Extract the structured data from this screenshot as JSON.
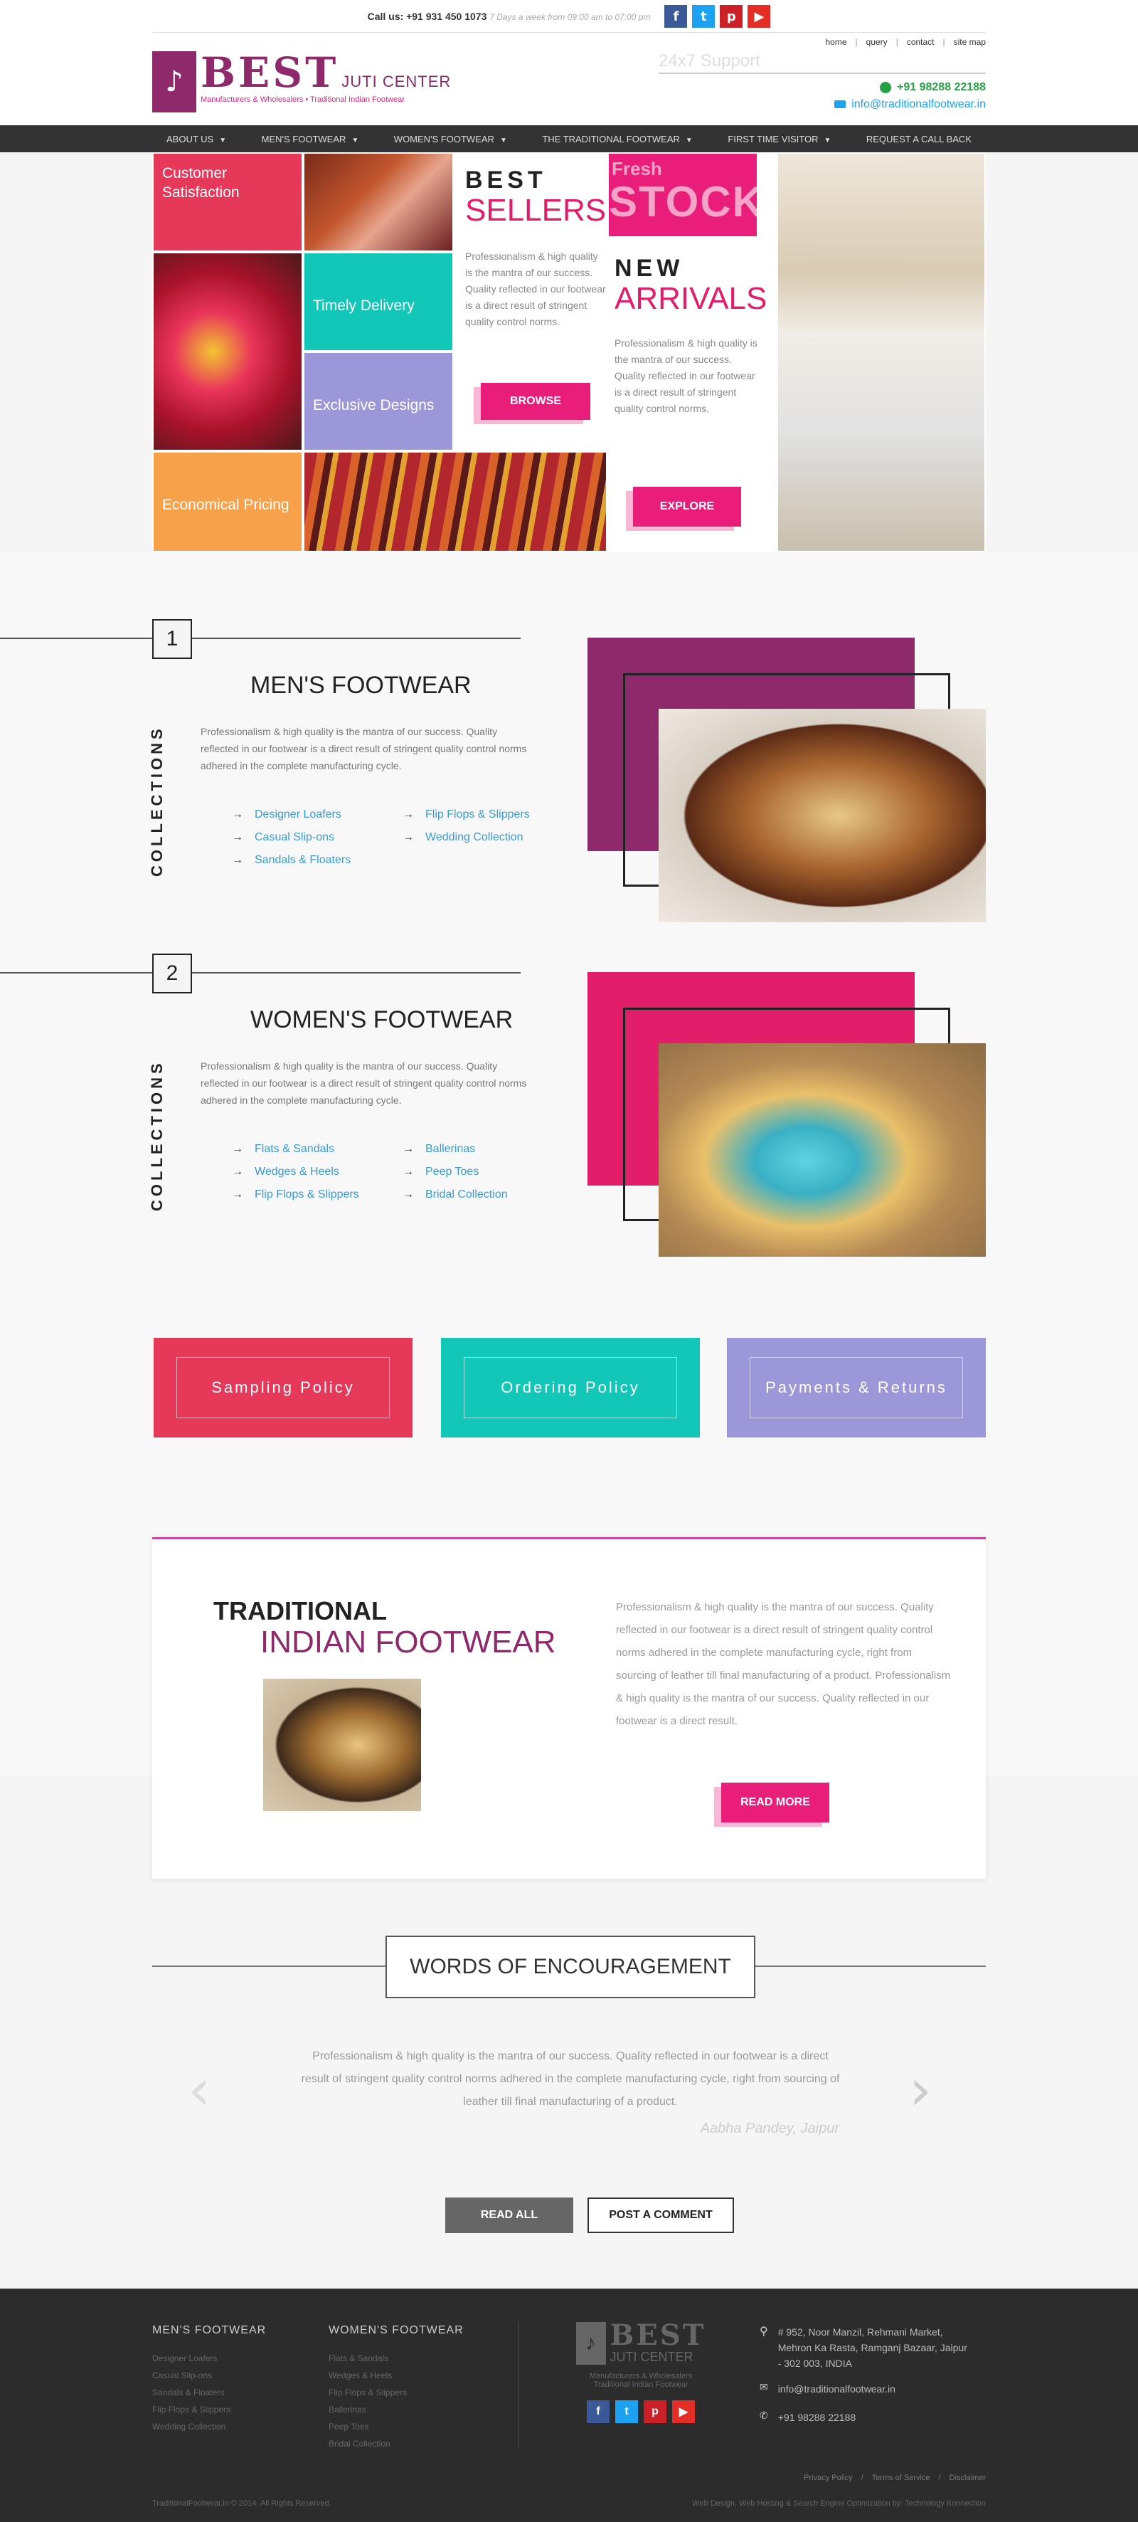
{
  "topbar": {
    "call_label": "Call us:",
    "phone": "+91 931 450 1073",
    "hours": "7 Days a week from 09:00 am to 07:00 pm"
  },
  "toplinks": [
    "home",
    "query",
    "contact",
    "site map"
  ],
  "logo": {
    "best": "BEST",
    "juti": "JUTI CENTER",
    "tagline": "Manufacturers & Wholesalers • Traditional Indian Footwear"
  },
  "support": {
    "title": "24x7 Support",
    "phone": "+91 98288 22188",
    "email": "info@traditionalfootwear.in"
  },
  "nav": [
    {
      "label": "ABOUT US",
      "caret": "▼"
    },
    {
      "label": "MEN'S FOOTWEAR",
      "caret": "▼"
    },
    {
      "label": "WOMEN'S FOOTWEAR",
      "caret": "▼"
    },
    {
      "label": "THE TRADITIONAL FOOTWEAR",
      "caret": "▼"
    },
    {
      "label": "FIRST TIME VISITOR",
      "caret": "▼"
    },
    {
      "label": "REQUEST A CALL BACK",
      "caret": ""
    }
  ],
  "hero": {
    "tiles": [
      "Customer Satisfaction",
      "Timely Delivery",
      "Exclusive Designs",
      "Economical Pricing"
    ],
    "best": "BEST",
    "sellers": "SELLERS",
    "best_text": "Professionalism & high quality is the mantra of our success. Quality reflected in our footwear is a direct result of stringent quality control norms.",
    "browse": "BROWSE",
    "fresh": "Fresh",
    "stock": "STOCK",
    "new": "NEW",
    "arrivals": "ARRIVALS",
    "new_text": "Professionalism & high quality is the mantra of our success. Quality reflected in our footwear is a direct result of stringent quality control norms.",
    "explore": "EXPLORE"
  },
  "collections": [
    {
      "num": "1",
      "vertical": "COLLECTIONS",
      "title": "MEN'S FOOTWEAR",
      "text": "Professionalism & high quality is the mantra of our success. Quality reflected in our footwear is a direct result of stringent quality control norms adhered in the complete manufacturing cycle.",
      "links": [
        "Designer Loafers",
        "Flip Flops & Slippers",
        "Casual Slip-ons",
        "Wedding Collection",
        "Sandals & Floaters"
      ],
      "accent": "#8e2a6b"
    },
    {
      "num": "2",
      "vertical": "COLLECTIONS",
      "title": "WOMEN'S FOOTWEAR",
      "text": "Professionalism & high quality is the mantra of our success. Quality reflected in our footwear is a direct result of stringent quality control norms adhered in the complete manufacturing cycle.",
      "links": [
        "Flats & Sandals",
        "Ballerinas",
        "Wedges & Heels",
        "Peep Toes",
        "Flip Flops & Slippers",
        "Bridal Collection"
      ],
      "accent": "#e21e6b"
    }
  ],
  "policies": [
    {
      "label": "Sampling Policy",
      "color": "#e6395a"
    },
    {
      "label": "Ordering Policy",
      "color": "#12c7b8"
    },
    {
      "label": "Payments & Returns",
      "color": "#9b97d8"
    }
  ],
  "traditional": {
    "line1": "TRADITIONAL",
    "line2": "INDIAN FOOTWEAR",
    "text": "Professionalism & high quality is the mantra of our success. Quality reflected in our footwear is a direct result of stringent quality control norms adhered in the complete manufacturing cycle, right from sourcing of leather till final manufacturing of a product. Professionalism & high quality is the mantra of our success. Quality reflected in our footwear is a direct result.",
    "button": "READ MORE"
  },
  "words": {
    "title": "WORDS OF ENCOURAGEMENT",
    "quote": "Professionalism & high quality is the mantra of our success. Quality reflected in our footwear is a direct result of stringent quality control norms adhered in the complete manufacturing cycle, right from sourcing of leather till final manufacturing of a product.",
    "author": "Aabha Pandey, Jaipur",
    "read_all": "READ ALL",
    "post": "POST A COMMENT"
  },
  "footer": {
    "men_title": "MEN'S FOOTWEAR",
    "men_links": [
      "Designer Loafers",
      "Casual Slip-ons",
      "Sandals & Floaters",
      "Flip Flops & Slippers",
      "Wedding Collection"
    ],
    "women_title": "WOMEN'S FOOTWEAR",
    "women_links": [
      "Flats & Sandals",
      "Wedges & Heels",
      "Flip Flops & Slippers",
      "Ballerinas",
      "Peep Toes",
      "Bridal Collection"
    ],
    "logo_best": "BEST",
    "logo_juti": "JUTI CENTER",
    "logo_tag1": "Manufacturers & Wholesalers",
    "logo_tag2": "Traditional Indian Footwear",
    "address": "# 952, Noor Manzil, Rehmani Market, Mehron Ka Rasta, Ramganj Bazaar, Jaipur - 302 003, INDIA",
    "email": "info@traditionalfootwear.in",
    "phone": "+91 98288 22188",
    "bottom_links": [
      "Privacy Policy",
      "Terms of Service",
      "Disclaimer"
    ],
    "copyright": "TraditionalFootwear.in © 2014. All Rights Reserved.",
    "credit": "Web Design, Web Hosting & Search Engine Optimization by: Technology Konnection"
  }
}
